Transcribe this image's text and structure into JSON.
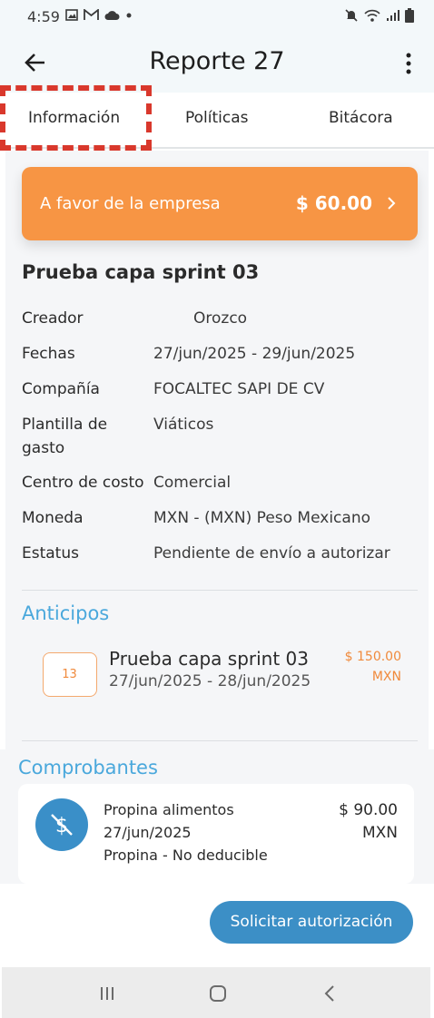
{
  "status_bar": {
    "time": "4:59",
    "left_icons": [
      "gallery-icon",
      "mail-icon",
      "cloud-icon",
      "dot-icon"
    ],
    "right_icons": [
      "mute-icon",
      "wifi-icon",
      "signal-icon",
      "battery-icon"
    ]
  },
  "header": {
    "title": "Reporte 27",
    "back_icon": "arrow-left-icon",
    "menu_icon": "more-vert-icon"
  },
  "tabs": [
    {
      "label": "Información",
      "selected": true
    },
    {
      "label": "Políticas",
      "selected": false
    },
    {
      "label": "Bitácora",
      "selected": false
    }
  ],
  "balance": {
    "label": "A favor de la empresa",
    "amount": "$ 60.00",
    "color": "#f79544"
  },
  "report": {
    "name": "Prueba capa sprint 03",
    "fields": [
      {
        "label": "Creador",
        "value": "Orozco"
      },
      {
        "label": "Fechas",
        "value": "27/jun/2025 - 29/jun/2025"
      },
      {
        "label": "Compañía",
        "value": "FOCALTEC SAPI DE CV"
      },
      {
        "label": "Plantilla de",
        "label2": "gasto",
        "value": "Viáticos"
      },
      {
        "label": "Centro de costo",
        "value": "Comercial"
      },
      {
        "label": "Moneda",
        "value": "MXN - (MXN) Peso Mexicano"
      },
      {
        "label": "Estatus",
        "value": "Pendiente de envío a autorizar"
      }
    ]
  },
  "advances": {
    "title": "Anticipos",
    "items": [
      {
        "badge": "13",
        "title": "Prueba capa sprint 03",
        "dates": "27/jun/2025 - 28/jun/2025",
        "amount": "$ 150.00",
        "currency": "MXN"
      }
    ]
  },
  "receipts": {
    "title": "Comprobantes",
    "items": [
      {
        "icon": "no-money-icon",
        "name": "Propina alimentos",
        "date": "27/jun/2025",
        "type": "Propina - No deducible",
        "amount": "$ 90.00",
        "currency": "MXN"
      }
    ]
  },
  "actions": {
    "request_label": "Solicitar autorización",
    "accent": "#3c8fc6"
  },
  "system_nav": [
    "recents-icon",
    "home-icon",
    "back-icon"
  ]
}
